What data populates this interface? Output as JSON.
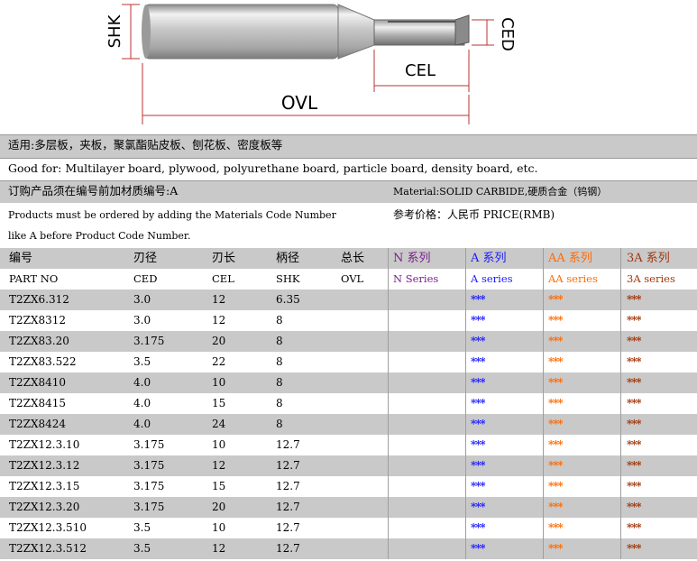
{
  "diagram": {
    "labels": {
      "shk": "SHK",
      "ced": "CED",
      "cel": "CEL",
      "ovl": "OVL"
    }
  },
  "info": {
    "applicable_zh": "适用:多层板，夹板，聚氯酯贴皮板、刨花板、密度板等",
    "good_for_en": "Good for: Multilayer board, plywood, polyurethane board, particle board, density board, etc.",
    "order_note_zh": "订购产品须在编号前加材质编号:A",
    "material": "Material:SOLID CARBIDE,硬质合金（钨钢）",
    "order_note_en_1": "Products must be ordered by adding the Materials Code Number",
    "order_note_en_2": "like A before Product Code Number.",
    "price": "参考价格：人民币  PRICE(RMB)"
  },
  "table": {
    "header_zh": [
      "编号",
      "刃径",
      "刃长",
      "柄径",
      "总长",
      "N 系列",
      "A 系列",
      "AA 系列",
      "3A 系列"
    ],
    "header_en": [
      "PART NO",
      "CED",
      "CEL",
      "SHK",
      "OVL",
      "N Series",
      "A series",
      "AA series",
      "3A series"
    ],
    "rows": [
      [
        "T2ZX6.312",
        "3.0",
        "12",
        "6.35",
        "",
        "",
        "***",
        "***",
        "***"
      ],
      [
        "T2ZX8312",
        "3.0",
        "12",
        "8",
        "",
        "",
        "***",
        "***",
        "***"
      ],
      [
        "T2ZX83.20",
        "3.175",
        "20",
        "8",
        "",
        "",
        "***",
        "***",
        "***"
      ],
      [
        "T2ZX83.522",
        "3.5",
        "22",
        "8",
        "",
        "",
        "***",
        "***",
        "***"
      ],
      [
        "T2ZX8410",
        "4.0",
        "10",
        "8",
        "",
        "",
        "***",
        "***",
        "***"
      ],
      [
        "T2ZX8415",
        "4.0",
        "15",
        "8",
        "",
        "",
        "***",
        "***",
        "***"
      ],
      [
        "T2ZX8424",
        "4.0",
        "24",
        "8",
        "",
        "",
        "***",
        "***",
        "***"
      ],
      [
        "T2ZX12.3.10",
        "3.175",
        "10",
        "12.7",
        "",
        "",
        "***",
        "***",
        "***"
      ],
      [
        "T2ZX12.3.12",
        "3.175",
        "12",
        "12.7",
        "",
        "",
        "***",
        "***",
        "***"
      ],
      [
        "T2ZX12.3.15",
        "3.175",
        "15",
        "12.7",
        "",
        "",
        "***",
        "***",
        "***"
      ],
      [
        "T2ZX12.3.20",
        "3.175",
        "20",
        "12.7",
        "",
        "",
        "***",
        "***",
        "***"
      ],
      [
        "T2ZX12.3.510",
        "3.5",
        "10",
        "12.7",
        "",
        "",
        "***",
        "***",
        "***"
      ],
      [
        "T2ZX12.3.512",
        "3.5",
        "12",
        "12.7",
        "",
        "",
        "***",
        "***",
        "***"
      ]
    ]
  },
  "colors": {
    "n_series": "#7a1f8c",
    "a_series": "#1a1aff",
    "aa_series": "#ff6a00",
    "a3_series": "#a0360a",
    "grey_band": "#c9c9c9"
  }
}
